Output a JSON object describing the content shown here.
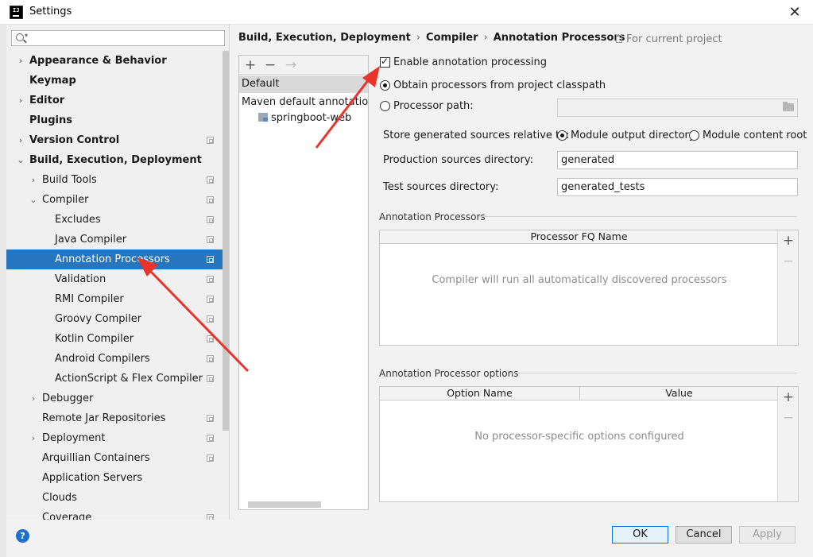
{
  "window": {
    "title": "Settings",
    "logo_text": "IJ"
  },
  "search": {
    "placeholder": "",
    "value": ""
  },
  "sidebar": {
    "items": [
      {
        "label": "Appearance & Behavior",
        "level": 0,
        "arrow": "›",
        "bold": true,
        "proj": false
      },
      {
        "label": "Keymap",
        "level": 0,
        "arrow": "",
        "bold": true,
        "proj": false
      },
      {
        "label": "Editor",
        "level": 0,
        "arrow": "›",
        "bold": true,
        "proj": false
      },
      {
        "label": "Plugins",
        "level": 0,
        "arrow": "",
        "bold": true,
        "proj": false
      },
      {
        "label": "Version Control",
        "level": 0,
        "arrow": "›",
        "bold": true,
        "proj": true
      },
      {
        "label": "Build, Execution, Deployment",
        "level": 0,
        "arrow": "⌄",
        "bold": true,
        "proj": false
      },
      {
        "label": "Build Tools",
        "level": 1,
        "arrow": "›",
        "bold": false,
        "proj": true
      },
      {
        "label": "Compiler",
        "level": 1,
        "arrow": "⌄",
        "bold": false,
        "proj": true
      },
      {
        "label": "Excludes",
        "level": 2,
        "arrow": "",
        "bold": false,
        "proj": true
      },
      {
        "label": "Java Compiler",
        "level": 2,
        "arrow": "",
        "bold": false,
        "proj": true
      },
      {
        "label": "Annotation Processors",
        "level": 2,
        "arrow": "",
        "bold": false,
        "proj": true,
        "selected": true
      },
      {
        "label": "Validation",
        "level": 2,
        "arrow": "",
        "bold": false,
        "proj": true
      },
      {
        "label": "RMI Compiler",
        "level": 2,
        "arrow": "",
        "bold": false,
        "proj": true
      },
      {
        "label": "Groovy Compiler",
        "level": 2,
        "arrow": "",
        "bold": false,
        "proj": true
      },
      {
        "label": "Kotlin Compiler",
        "level": 2,
        "arrow": "",
        "bold": false,
        "proj": true
      },
      {
        "label": "Android Compilers",
        "level": 2,
        "arrow": "",
        "bold": false,
        "proj": true
      },
      {
        "label": "ActionScript & Flex Compiler",
        "level": 2,
        "arrow": "",
        "bold": false,
        "proj": true
      },
      {
        "label": "Debugger",
        "level": 1,
        "arrow": "›",
        "bold": false,
        "proj": false
      },
      {
        "label": "Remote Jar Repositories",
        "level": 1,
        "arrow": "",
        "bold": false,
        "proj": true
      },
      {
        "label": "Deployment",
        "level": 1,
        "arrow": "›",
        "bold": false,
        "proj": true
      },
      {
        "label": "Arquillian Containers",
        "level": 1,
        "arrow": "",
        "bold": false,
        "proj": true
      },
      {
        "label": "Application Servers",
        "level": 1,
        "arrow": "",
        "bold": false,
        "proj": false
      },
      {
        "label": "Clouds",
        "level": 1,
        "arrow": "",
        "bold": false,
        "proj": false
      },
      {
        "label": "Coverage",
        "level": 1,
        "arrow": "",
        "bold": false,
        "proj": true
      }
    ]
  },
  "breadcrumb": {
    "part1": "Build, Execution, Deployment",
    "sep": "›",
    "part2": "Compiler",
    "part3": "Annotation Processors"
  },
  "scope_note": "For current project",
  "profiles": {
    "add": "+",
    "remove": "−",
    "move": "→",
    "default": "Default",
    "maven": "Maven default annotation p",
    "module": "springboot-web"
  },
  "form": {
    "enable_label": "Enable annotation processing",
    "obtain_label": "Obtain processors from project classpath",
    "path_label": "Processor path:",
    "path_value": "",
    "store_label": "Store generated sources relative to:",
    "module_output_label": "Module output directory",
    "module_content_label": "Module content root",
    "prod_label": "Production sources directory:",
    "prod_value": "generated",
    "test_label": "Test sources directory:",
    "test_value": "generated_tests"
  },
  "processors_table": {
    "title": "Annotation Processors",
    "column": "Processor FQ Name",
    "empty": "Compiler will run all automatically discovered processors",
    "add": "+",
    "remove": "−"
  },
  "options_table": {
    "title": "Annotation Processor options",
    "col1": "Option Name",
    "col2": "Value",
    "empty": "No processor-specific options configured",
    "add": "+",
    "remove": "−"
  },
  "buttons": {
    "help": "?",
    "ok": "OK",
    "cancel": "Cancel",
    "apply": "Apply"
  },
  "colors": {
    "selection": "#2675bf",
    "annotation_arrow": "#e8342a"
  }
}
